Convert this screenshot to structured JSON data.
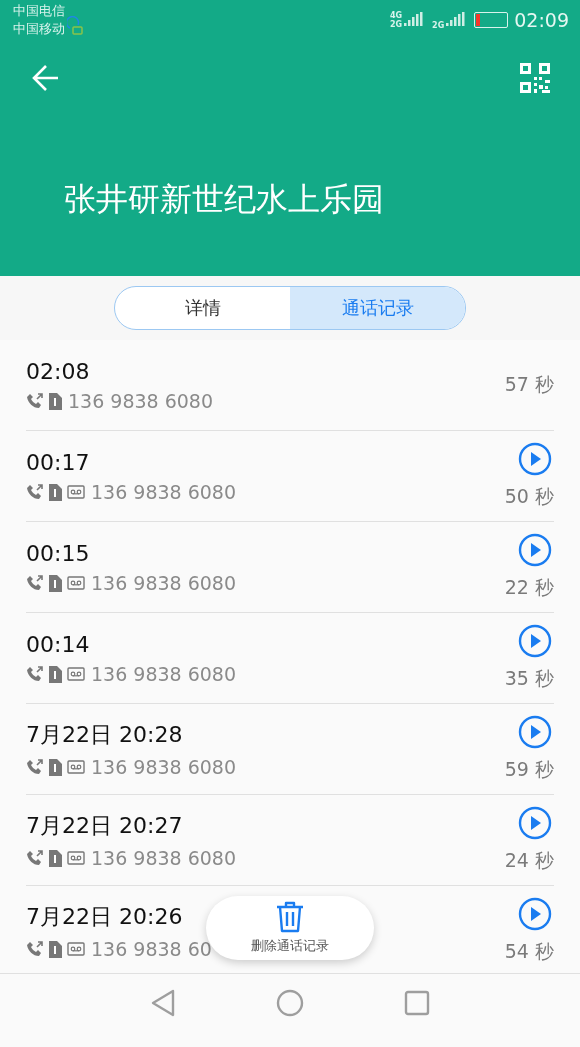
{
  "status_bar": {
    "carriers": [
      "中国电信",
      "中国移动"
    ],
    "network_labels": [
      "4G",
      "2G",
      "2G"
    ],
    "time": "02:09"
  },
  "header": {
    "title": "张井研新世纪水上乐园"
  },
  "tabs": [
    {
      "label": "详情",
      "selected": false
    },
    {
      "label": "通话记录",
      "selected": true
    }
  ],
  "calls": [
    {
      "time": "02:08",
      "number": "136 9838 6080",
      "duration": "57 秒",
      "recording": false
    },
    {
      "time": "00:17",
      "number": "136 9838 6080",
      "duration": "50 秒",
      "recording": true
    },
    {
      "time": "00:15",
      "number": "136 9838 6080",
      "duration": "22 秒",
      "recording": true
    },
    {
      "time": "00:14",
      "number": "136 9838 6080",
      "duration": "35 秒",
      "recording": true
    },
    {
      "time": "7月22日 20:28",
      "number": "136 9838 6080",
      "duration": "59 秒",
      "recording": true
    },
    {
      "time": "7月22日 20:27",
      "number": "136 9838 6080",
      "duration": "24 秒",
      "recording": true
    },
    {
      "time": "7月22日 20:26",
      "number": "136 9838 60",
      "duration": "54 秒",
      "recording": true
    }
  ],
  "delete_button": {
    "label": "删除通话记录"
  }
}
